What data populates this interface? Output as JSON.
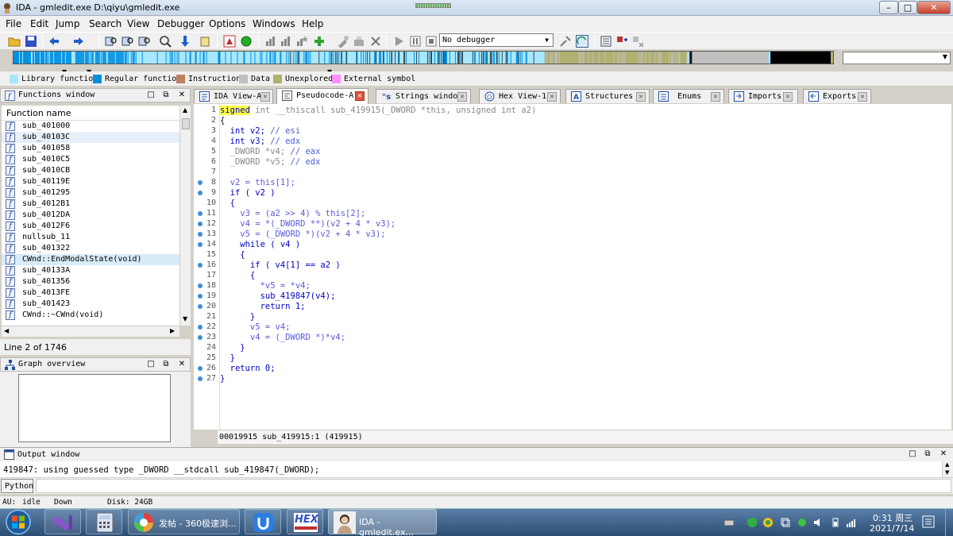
{
  "app": {
    "title": "IDA - gmledit.exe D:\\qiyu\\gmledit.exe"
  },
  "menu": [
    "File",
    "Edit",
    "Jump",
    "Search",
    "View",
    "Debugger",
    "Options",
    "Windows",
    "Help"
  ],
  "toolbar": {
    "debugger_value": "No debugger"
  },
  "legend": [
    {
      "label": "Library function",
      "color": "#a8e8ff"
    },
    {
      "label": "Regular function",
      "color": "#0090e0"
    },
    {
      "label": "Instruction",
      "color": "#c08060"
    },
    {
      "label": "Data",
      "color": "#c0c0c0"
    },
    {
      "label": "Unexplored",
      "color": "#b0b070"
    },
    {
      "label": "External symbol",
      "color": "#ff90ff"
    }
  ],
  "functions_panel": {
    "title": "Functions window",
    "column": "Function name",
    "items": [
      "sub_401000",
      "sub_40103C",
      "sub_401058",
      "sub_4010C5",
      "sub_4010CB",
      "sub_40119E",
      "sub_401295",
      "sub_4012B1",
      "sub_4012DA",
      "sub_4012F6",
      "nullsub_11",
      "sub_401322",
      "CWnd::EndModalState(void)",
      "sub_40133A",
      "sub_401356",
      "sub_4013FE",
      "sub_401423",
      "CWnd::~CWnd(void)"
    ],
    "status": "Line 2 of 1746"
  },
  "graph_panel": {
    "title": "Graph overview"
  },
  "tabs": [
    {
      "label": "IDA View-A",
      "active": false
    },
    {
      "label": "Pseudocode-A",
      "active": true
    },
    {
      "label": "Strings window",
      "active": false
    },
    {
      "label": "Hex View-1",
      "active": false
    },
    {
      "label": "Structures",
      "active": false
    },
    {
      "label": "Enums",
      "active": false
    },
    {
      "label": "Imports",
      "active": false
    },
    {
      "label": "Exports",
      "active": false
    }
  ],
  "code": {
    "line_numbers": [
      "1",
      "2",
      "3",
      "4",
      "5",
      "6",
      "7",
      "8",
      "9",
      "10",
      "11",
      "12",
      "13",
      "14",
      "15",
      "16",
      "17",
      "18",
      "19",
      "20",
      "21",
      "22",
      "23",
      "24",
      "25",
      "26",
      "27"
    ],
    "l1_a": "signed",
    "l1_b": " int __thiscall sub_419915(_DWORD *this, unsigned int a2)",
    "l2": "{",
    "l3_a": "  int v2; ",
    "l3_b": "// esi",
    "l4_a": "  int v3; ",
    "l4_b": "// edx",
    "l5_a": "  _DWORD *v4; ",
    "l5_b": "// eax",
    "l6_a": "  _DWORD *v5; ",
    "l6_b": "// edx",
    "l8": "  v2 = this[1];",
    "l9": "  if ( v2 )",
    "l10": "  {",
    "l11": "    v3 = (a2 >> 4) % this[2];",
    "l12": "    v4 = *(_DWORD **)(v2 + 4 * v3);",
    "l13": "    v5 = (_DWORD *)(v2 + 4 * v3);",
    "l14": "    while ( v4 )",
    "l15": "    {",
    "l16": "      if ( v4[1] == a2 )",
    "l17": "      {",
    "l18": "        *v5 = *v4;",
    "l19": "        sub_419847(v4);",
    "l20": "        return 1;",
    "l21": "      }",
    "l22": "      v5 = v4;",
    "l23": "      v4 = (_DWORD *)*v4;",
    "l24": "    }",
    "l25": "  }",
    "l26": "  return 0;",
    "l27": "}",
    "status": "00019915 sub_419915:1 (419915)"
  },
  "output": {
    "title": "Output window",
    "line": "419847: using guessed type _DWORD __stdcall sub_419847(_DWORD);",
    "python_button": "Python"
  },
  "statusbar": {
    "au": "AU:",
    "state": "idle",
    "dir": "Down",
    "disk": "Disk: 24GB"
  },
  "taskbar": {
    "items": [
      {
        "label": "发帖 - 360极速浏..."
      },
      {
        "label": "IDA - gmledit.ex..."
      }
    ],
    "hex_icon_text": "HEX",
    "time": "0:31 周三",
    "date": "2021/7/14"
  }
}
